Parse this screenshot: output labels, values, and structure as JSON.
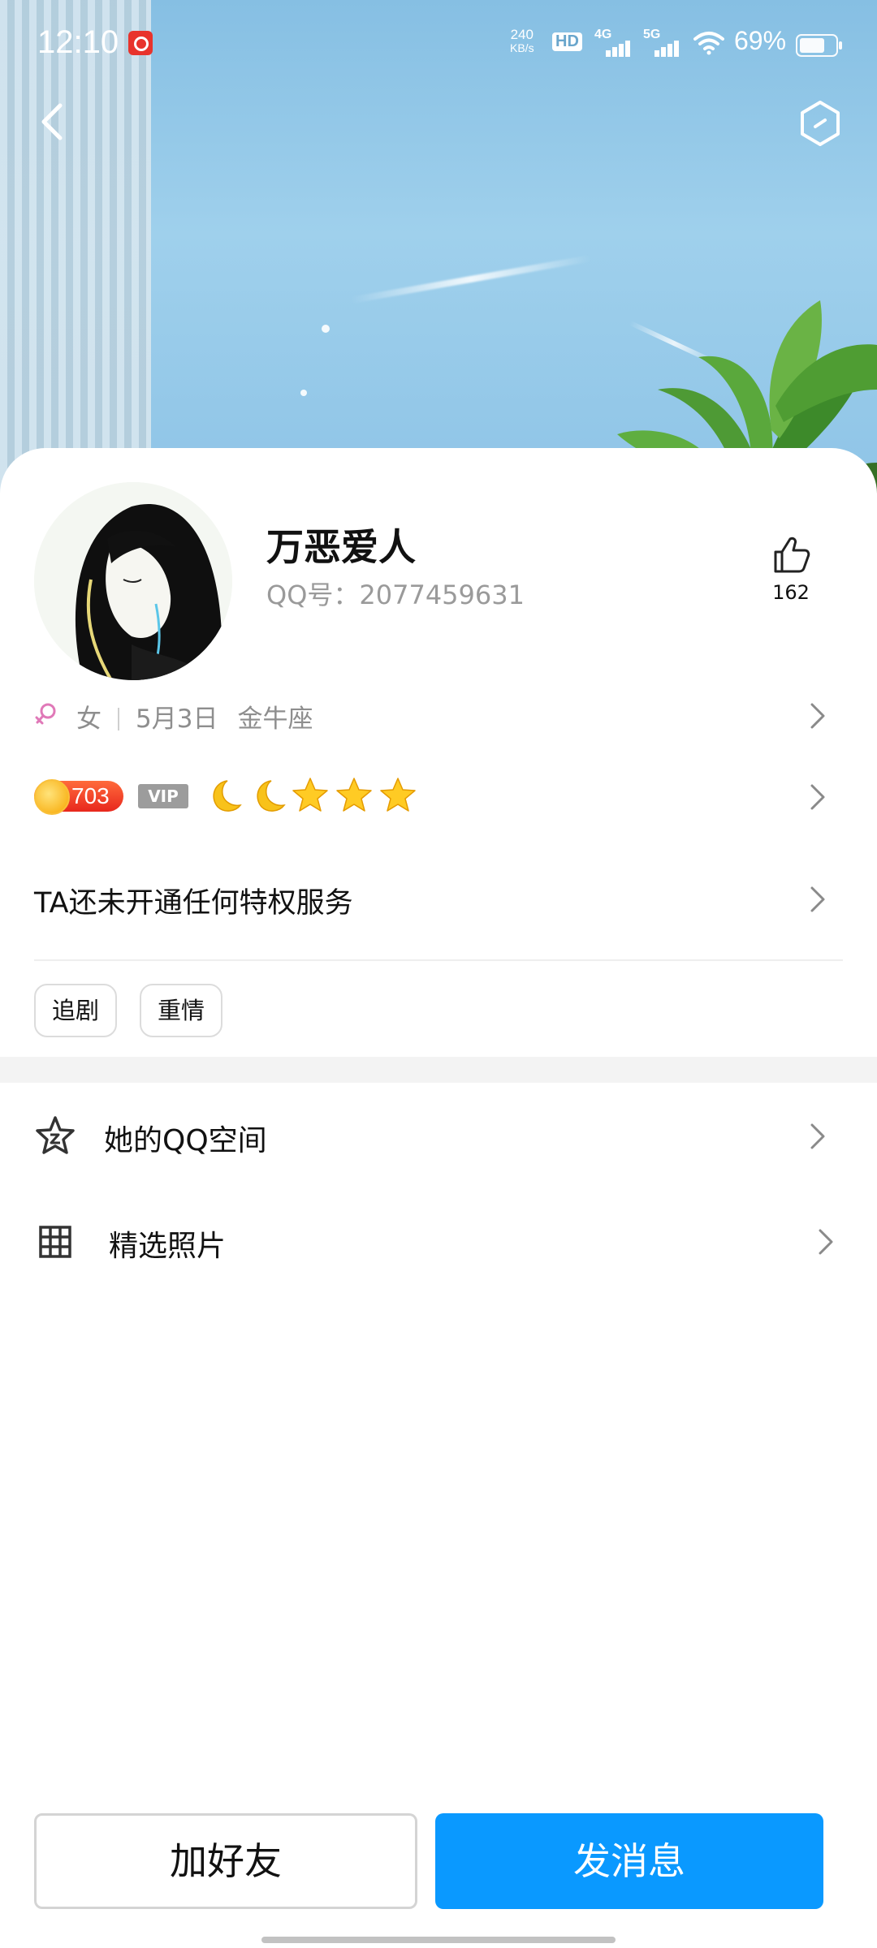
{
  "status_bar": {
    "time": "12:10",
    "net_speed_value": "240",
    "net_speed_unit": "KB/s",
    "hd_label": "HD",
    "signal_1_label": "4G",
    "signal_2_label": "5G",
    "battery": "69%"
  },
  "profile": {
    "nickname": "万恶爱人",
    "qq_number": "QQ号：2077459631",
    "likes": "162",
    "gender": "女",
    "birthday": "5月3日",
    "zodiac": "金牛座"
  },
  "level": {
    "coin_value": "703",
    "vip_label": "VIP",
    "icons": [
      "moon-icon",
      "moon-icon",
      "star-icon",
      "star-icon",
      "star-icon"
    ]
  },
  "privilege": {
    "text": "TA还未开通任何特权服务"
  },
  "tags": [
    "追剧",
    "重情"
  ],
  "menu": [
    {
      "label": "她的QQ空间",
      "icon": "qzone-star-icon"
    },
    {
      "label": "精选照片",
      "icon": "grid-icon"
    }
  ],
  "actions": {
    "add_friend": "加好友",
    "send_message": "发消息"
  },
  "colors": {
    "primary": "#0a99ff",
    "coin": "#e8271d",
    "gender": "#e079b8"
  }
}
